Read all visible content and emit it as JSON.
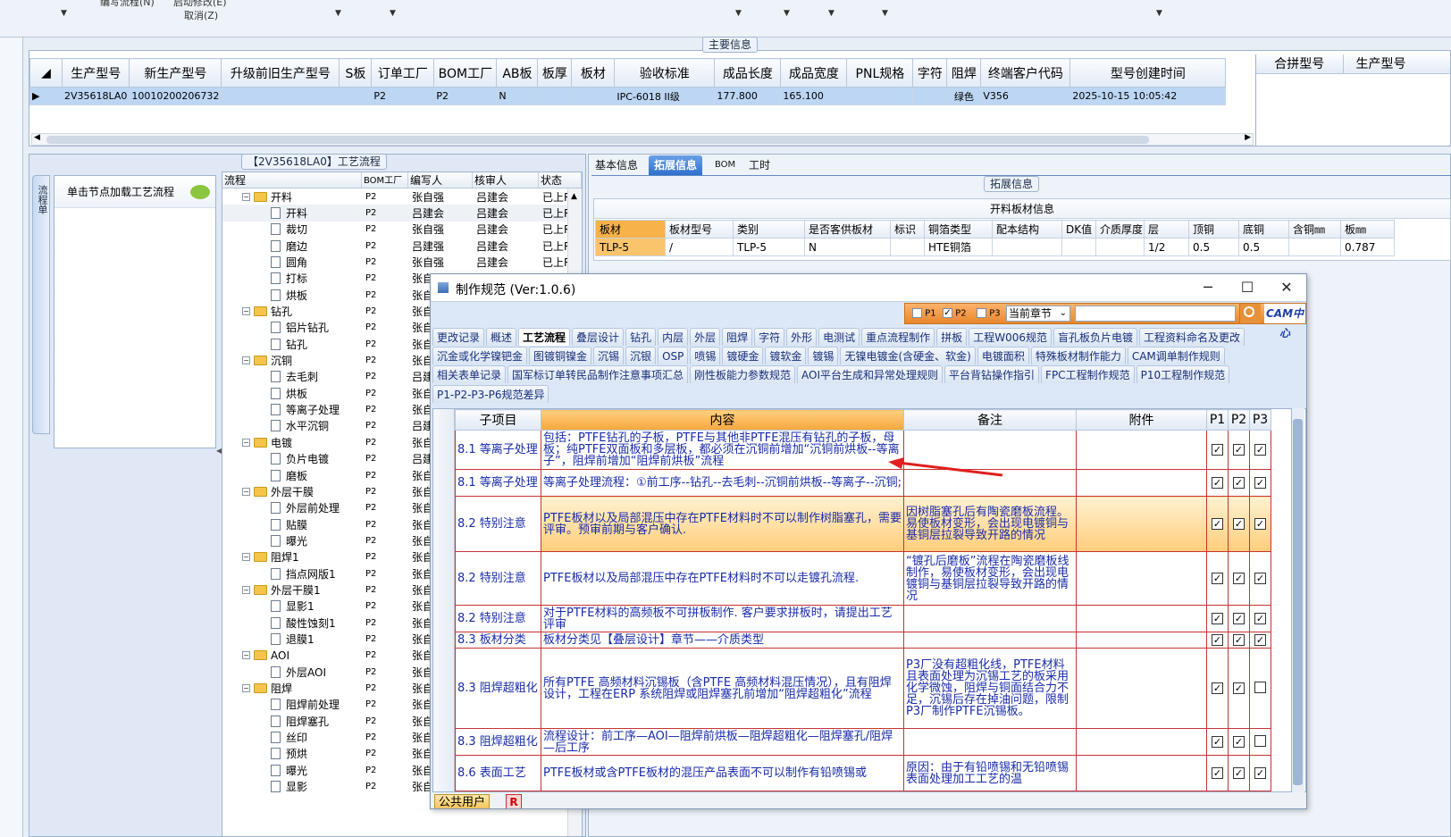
{
  "top": {
    "menu_row1_left": "编写流程(N)",
    "menu_row1_right": "启动修改(E)",
    "menu_row2": "取消(Z)"
  },
  "main_group_title": "主要信息",
  "main_grid": {
    "columns": [
      "生产型号",
      "新生产型号",
      "升级前旧生产型号",
      "S板",
      "订单工厂",
      "BOM工厂",
      "AB板",
      "板厚",
      "板材",
      "验收标准",
      "成品长度",
      "成品宽度",
      "PNL规格",
      "字符",
      "阻焊",
      "终端客户代码",
      "型号创建时间"
    ],
    "row": [
      "2V35618LA0",
      "10010200206732",
      "",
      "",
      "P2",
      "P2",
      "N",
      "",
      "",
      "IPC-6018 II级",
      "177.800",
      "165.100",
      "",
      "",
      "绿色",
      "V356",
      "2025-10-15 10:05:42"
    ]
  },
  "side_grid": {
    "columns": [
      "合拼型号",
      "生产型号"
    ]
  },
  "process": {
    "title": "【2V35618LA0】工艺流程",
    "left_tab": "流程单",
    "load_hint": "单击节点加载工艺流程",
    "columns": [
      "流程",
      "BOM工厂",
      "编写人",
      "核审人",
      "状态"
    ],
    "rows": [
      {
        "name": "开料",
        "type": "folder",
        "bom": "P2",
        "writer": "张自强",
        "reviewer": "吕建会",
        "status": "已上R"
      },
      {
        "name": "开料",
        "type": "leaf",
        "bom": "P2",
        "writer": "吕建会",
        "reviewer": "吕建会",
        "status": "已上R"
      },
      {
        "name": "裁切",
        "type": "leaf",
        "bom": "P2",
        "writer": "张自强",
        "reviewer": "吕建会",
        "status": "已上R"
      },
      {
        "name": "磨边",
        "type": "leaf",
        "bom": "P2",
        "writer": "吕建强",
        "reviewer": "吕建会",
        "status": "已上R"
      },
      {
        "name": "圆角",
        "type": "leaf",
        "bom": "P2",
        "writer": "张自强",
        "reviewer": "吕建会",
        "status": "已上R"
      },
      {
        "name": "打标",
        "type": "leaf",
        "bom": "P2",
        "writer": "张自",
        "reviewer": "",
        "status": ""
      },
      {
        "name": "烘板",
        "type": "leaf",
        "bom": "P2",
        "writer": "张自",
        "reviewer": "",
        "status": ""
      },
      {
        "name": "钻孔",
        "type": "folder",
        "bom": "P2",
        "writer": "张自",
        "reviewer": "",
        "status": ""
      },
      {
        "name": "铝片钻孔",
        "type": "leaf",
        "bom": "P2",
        "writer": "张自",
        "reviewer": "",
        "status": ""
      },
      {
        "name": "钻孔",
        "type": "leaf",
        "bom": "P2",
        "writer": "张自",
        "reviewer": "",
        "status": ""
      },
      {
        "name": "沉铜",
        "type": "folder",
        "bom": "P2",
        "writer": "张自",
        "reviewer": "",
        "status": ""
      },
      {
        "name": "去毛刺",
        "type": "leaf",
        "bom": "P2",
        "writer": "吕建",
        "reviewer": "",
        "status": ""
      },
      {
        "name": "烘板",
        "type": "leaf",
        "bom": "P2",
        "writer": "张自",
        "reviewer": "",
        "status": ""
      },
      {
        "name": "等离子处理",
        "type": "leaf",
        "bom": "P2",
        "writer": "张自",
        "reviewer": "",
        "status": ""
      },
      {
        "name": "水平沉铜",
        "type": "leaf",
        "bom": "P2",
        "writer": "吕建",
        "reviewer": "",
        "status": ""
      },
      {
        "name": "电镀",
        "type": "folder",
        "bom": "P2",
        "writer": "张自",
        "reviewer": "",
        "status": ""
      },
      {
        "name": "负片电镀",
        "type": "leaf",
        "bom": "P2",
        "writer": "吕建",
        "reviewer": "",
        "status": ""
      },
      {
        "name": "磨板",
        "type": "leaf",
        "bom": "P2",
        "writer": "张自",
        "reviewer": "",
        "status": ""
      },
      {
        "name": "外层干膜",
        "type": "folder",
        "bom": "P2",
        "writer": "张自",
        "reviewer": "",
        "status": ""
      },
      {
        "name": "外层前处理",
        "type": "leaf",
        "bom": "P2",
        "writer": "张自",
        "reviewer": "",
        "status": ""
      },
      {
        "name": "贴膜",
        "type": "leaf",
        "bom": "P2",
        "writer": "张自",
        "reviewer": "",
        "status": ""
      },
      {
        "name": "曝光",
        "type": "leaf",
        "bom": "P2",
        "writer": "张自",
        "reviewer": "",
        "status": ""
      },
      {
        "name": "阻焊1",
        "type": "folder",
        "bom": "P2",
        "writer": "张自",
        "reviewer": "",
        "status": ""
      },
      {
        "name": "挡点网版1",
        "type": "leaf",
        "bom": "P2",
        "writer": "张自",
        "reviewer": "",
        "status": ""
      },
      {
        "name": "外层干膜1",
        "type": "folder",
        "bom": "P2",
        "writer": "张自",
        "reviewer": "",
        "status": ""
      },
      {
        "name": "显影1",
        "type": "leaf",
        "bom": "P2",
        "writer": "张自",
        "reviewer": "",
        "status": ""
      },
      {
        "name": "酸性蚀刻1",
        "type": "leaf",
        "bom": "P2",
        "writer": "张自",
        "reviewer": "",
        "status": ""
      },
      {
        "name": "退膜1",
        "type": "leaf",
        "bom": "P2",
        "writer": "张自",
        "reviewer": "",
        "status": ""
      },
      {
        "name": "AOI",
        "type": "folder",
        "bom": "P2",
        "writer": "张自",
        "reviewer": "",
        "status": ""
      },
      {
        "name": "外层AOI",
        "type": "leaf",
        "bom": "P2",
        "writer": "张自",
        "reviewer": "",
        "status": ""
      },
      {
        "name": "阻焊",
        "type": "folder",
        "bom": "P2",
        "writer": "张自",
        "reviewer": "",
        "status": ""
      },
      {
        "name": "阻焊前处理",
        "type": "leaf",
        "bom": "P2",
        "writer": "张自",
        "reviewer": "",
        "status": ""
      },
      {
        "name": "阻焊塞孔",
        "type": "leaf",
        "bom": "P2",
        "writer": "张自",
        "reviewer": "",
        "status": ""
      },
      {
        "name": "丝印",
        "type": "leaf",
        "bom": "P2",
        "writer": "张自",
        "reviewer": "",
        "status": ""
      },
      {
        "name": "预烘",
        "type": "leaf",
        "bom": "P2",
        "writer": "张自",
        "reviewer": "",
        "status": ""
      },
      {
        "name": "曝光",
        "type": "leaf",
        "bom": "P2",
        "writer": "张自",
        "reviewer": "",
        "status": ""
      },
      {
        "name": "显影",
        "type": "leaf",
        "bom": "P2",
        "writer": "张自",
        "reviewer": "",
        "status": ""
      }
    ]
  },
  "right_tabs": [
    "基本信息",
    "拓展信息",
    "BOM",
    "工时"
  ],
  "ext": {
    "group_title": "拓展信息",
    "sub_title": "开料板材信息",
    "columns": [
      "板材",
      "板材型号",
      "类别",
      "是否客供板材",
      "标识",
      "铜箔类型",
      "配本结构",
      "DK值",
      "介质厚度",
      "层",
      "顶铜",
      "底铜",
      "含铜㎜",
      "板㎜"
    ],
    "row": [
      "TLP-5",
      "/",
      "TLP-5",
      "N",
      "",
      "HTE铜箔",
      "",
      "",
      "",
      "1/2",
      "0.5",
      "0.5",
      "",
      "0.787"
    ]
  },
  "dialog": {
    "title": "制作规范 (Ver:1.0.6)",
    "minimize": "─",
    "maximize": "☐",
    "close": "✕",
    "filters": [
      {
        "label": "P1",
        "checked": false
      },
      {
        "label": "P2",
        "checked": true
      },
      {
        "label": "P3",
        "checked": false
      }
    ],
    "scope_select": "当前章节",
    "search_placeholder": "",
    "logo": "CAM中心",
    "tabs_row1": [
      "更改记录",
      "概述",
      "工艺流程",
      "叠层设计",
      "钻孔",
      "内层",
      "外层",
      "阻焊",
      "字符",
      "外形",
      "电测试",
      "重点流程制作",
      "拼板",
      "工程W006规范",
      "盲孔板负片电镀",
      "工程资料命名及更改"
    ],
    "tabs_row2": [
      "沉金或化学镍钯金",
      "图镀铜镍金",
      "沉锡",
      "沉银",
      "OSP",
      "喷锡",
      "镀硬金",
      "镀软金",
      "镀锡",
      "无镍电镀金(含硬金、软金)",
      "电镀面积",
      "特殊板材制作能力",
      "CAM调单制作规则"
    ],
    "tabs_row3": [
      "相关表单记录",
      "国军标订单转民品制作注意事项汇总",
      "刚性板能力参数规范",
      "AOI平台生成和异常处理规则",
      "平台背钻操作指引",
      "FPC工程制作规范",
      "P10工程制作规范"
    ],
    "tabs_row4": [
      "P1-P2-P3-P6规范差异"
    ],
    "active_tab": "工艺流程",
    "grid_columns": [
      "子项目",
      "内容",
      "备注",
      "附件",
      "P1",
      "P2",
      "P3"
    ],
    "grid_rows": [
      {
        "item": "8.1 等离子处理",
        "content": "包括：PTFE钻孔的子板，PTFE与其他非PTFE混压有钻孔的子板，母板；纯PTFE双面板和多层板，都必须在沉铜前增加“沉铜前烘板--等离子”，阻焊前增加“阻焊前烘板”流程",
        "note": "",
        "attach": "",
        "p1": true,
        "p2": true,
        "p3": true,
        "highlight": false
      },
      {
        "item": "8.1 等离子处理",
        "content": "等离子处理流程：①前工序--钻孔--去毛刺--沉铜前烘板--等离子--沉铜;",
        "note": "",
        "attach": "",
        "p1": true,
        "p2": true,
        "p3": true,
        "highlight": false
      },
      {
        "item": "8.2 特别注意",
        "content": "PTFE板材以及局部混压中存在PTFE材料时不可以制作树脂塞孔，需要评审。预审前期与客户确认.",
        "note": "因树脂塞孔后有陶瓷磨板流程。易使板材变形，会出现电镀铜与基铜层拉裂导致开路的情况",
        "attach": "",
        "p1": true,
        "p2": true,
        "p3": true,
        "highlight": true
      },
      {
        "item": "8.2 特别注意",
        "content": "PTFE板材以及局部混压中存在PTFE材料时不可以走镀孔流程.",
        "note": "“镀孔后磨板”流程在陶瓷磨板线制作，易使板材变形，会出现电镀铜与基铜层拉裂导致开路的情况",
        "attach": "",
        "p1": true,
        "p2": true,
        "p3": true,
        "highlight": false
      },
      {
        "item": "8.2 特别注意",
        "content": "对于PTFE材料的高频板不可拼板制作. 客户要求拼板时，请提出工艺评审",
        "note": "",
        "attach": "",
        "p1": true,
        "p2": true,
        "p3": true,
        "highlight": false
      },
      {
        "item": "8.3 板材分类",
        "content": "板材分类见【叠层设计】章节——介质类型",
        "note": "",
        "attach": "",
        "p1": true,
        "p2": true,
        "p3": true,
        "highlight": false
      },
      {
        "item": "8.3 阻焊超粗化",
        "content": "所有PTFE 高频材料沉锡板（含PTFE 高频材料混压情况），且有阻焊设计，工程在ERP 系统阻焊或阻焊塞孔前增加“阻焊超粗化”流程",
        "note": "P3厂没有超粗化线，PTFE材料且表面处理为沉锡工艺的板采用化学微蚀，阻焊与铜面结合力不足，沉锡后存在掉油问题，限制P3厂制作PTFE沉锡板。",
        "attach": "",
        "p1": true,
        "p2": true,
        "p3": false,
        "highlight": false
      },
      {
        "item": "8.3 阻焊超粗化",
        "content": "流程设计：前工序—AOI—阻焊前烘板—阻焊超粗化—阻焊塞孔/阻焊—后工序",
        "note": "",
        "attach": "",
        "p1": true,
        "p2": true,
        "p3": false,
        "highlight": false
      },
      {
        "item": "8.6 表面工艺",
        "content": "PTFE板材或含PTFE板材的混压产品表面不可以制作有铅喷锡或",
        "note": "原因：由于有铅喷锡和无铅喷锡表面处理加工工艺的温",
        "attach": "",
        "p1": true,
        "p2": true,
        "p3": true,
        "highlight": false
      }
    ],
    "bottom_tab": "公共用户",
    "bottom_btn": "R"
  }
}
